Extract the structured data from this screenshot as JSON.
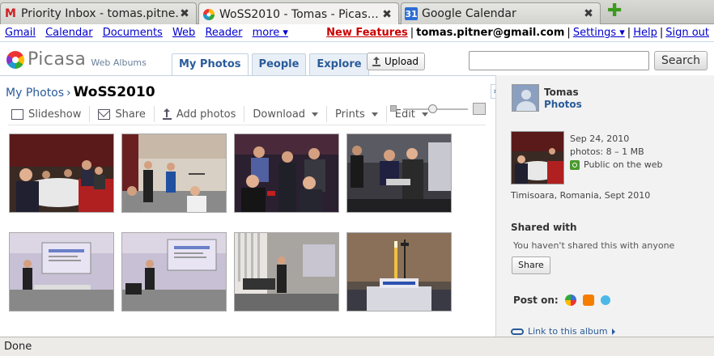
{
  "browser": {
    "tabs": [
      {
        "title": "Priority Inbox - tomas.pitne…",
        "favicon": "gmail-icon"
      },
      {
        "title": "WoSS2010 - Tomas - Picas…",
        "favicon": "picasa-icon"
      },
      {
        "title": "Google Calendar",
        "favicon": "calendar-icon",
        "favicon_text": "31"
      }
    ],
    "close_glyph": "✖",
    "new_tab_glyph": "✚"
  },
  "gbar": {
    "left": [
      "Gmail",
      "Calendar",
      "Documents",
      "Web",
      "Reader",
      "more ▾"
    ],
    "new_features": "New Features",
    "email": "tomas.pitner@gmail.com",
    "settings": "Settings ▾",
    "help": "Help",
    "signout": "Sign out",
    "sep": "|"
  },
  "picasa": {
    "logo_word": "Picasa",
    "logo_sub": "Web Albums",
    "tabs": [
      "My Photos",
      "People",
      "Explore"
    ],
    "upload_label": "Upload",
    "search_placeholder": "",
    "search_button": "Search"
  },
  "album": {
    "crumb_link": "My Photos",
    "crumb_arrow": "›",
    "title": "WoSS2010",
    "toolbar": {
      "slideshow": "Slideshow",
      "share": "Share",
      "add_photos": "Add photos",
      "download": "Download",
      "prints": "Prints",
      "edit": "Edit"
    },
    "zoom_level": 0.45
  },
  "sidebar": {
    "expand_glyph": "»",
    "user_name": "Tomas",
    "user_link": "Photos",
    "date": "Sep 24, 2010",
    "photos_info": "photos: 8 – 1 MB",
    "visibility": "Public on the web",
    "place": "Timisoara, Romania, Sept 2010",
    "shared_heading": "Shared with",
    "shared_text": "You haven't shared this with anyone",
    "share_button": "Share",
    "post_on": "Post on:",
    "link_album": "Link to this album"
  },
  "status": {
    "text": "Done"
  }
}
